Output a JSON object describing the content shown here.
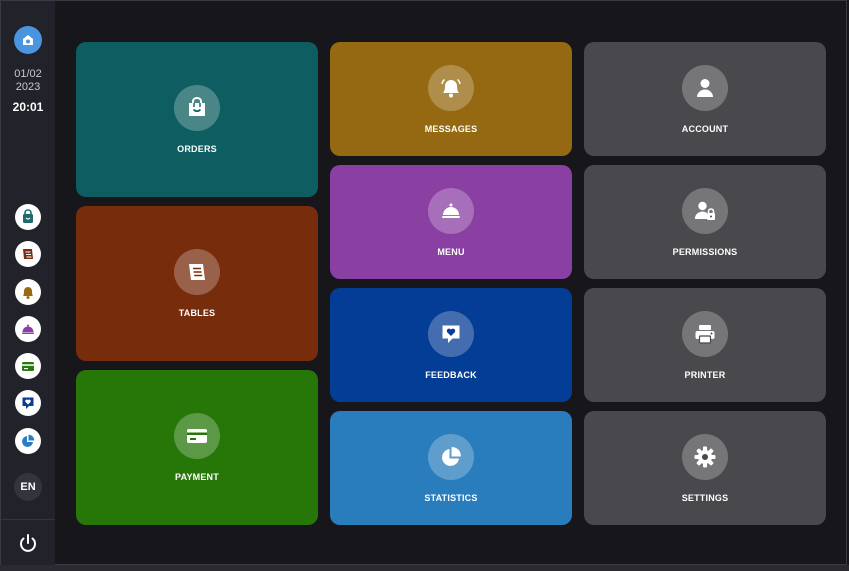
{
  "sidebar": {
    "date_line1": "01/02",
    "date_line2": "2023",
    "time": "20:01",
    "language": "EN",
    "icons": [
      {
        "name": "orders",
        "color": "#1f6b6b"
      },
      {
        "name": "tables",
        "color": "#7a2c10"
      },
      {
        "name": "messages",
        "color": "#9a6a12"
      },
      {
        "name": "menu",
        "color": "#8b3fa6"
      },
      {
        "name": "payment",
        "color": "#277a10"
      },
      {
        "name": "feedback",
        "color": "#0a3d94"
      },
      {
        "name": "statistics",
        "color": "#2a7fc4"
      }
    ]
  },
  "tiles": {
    "orders": {
      "label": "ORDERS",
      "color": "#0e5e61",
      "icon": "shopping-bag-icon"
    },
    "tables": {
      "label": "TABLES",
      "color": "#772c0c",
      "icon": "table-icon"
    },
    "payment": {
      "label": "PAYMENT",
      "color": "#267708",
      "icon": "credit-card-icon"
    },
    "messages": {
      "label": "MESSAGES",
      "color": "#946911",
      "icon": "bell-icon"
    },
    "menu": {
      "label": "MENU",
      "color": "#8a3fa3",
      "icon": "cloche-icon"
    },
    "feedback": {
      "label": "FEEDBACK",
      "color": "#043d95",
      "icon": "heart-message-icon"
    },
    "statistics": {
      "label": "STATISTICS",
      "color": "#2a7dbd",
      "icon": "pie-chart-icon"
    },
    "account": {
      "label": "ACCOUNT",
      "color": "#48484d",
      "icon": "user-icon"
    },
    "permissions": {
      "label": "PERMISSIONS",
      "color": "#48484d",
      "icon": "user-lock-icon"
    },
    "printer": {
      "label": "PRINTER",
      "color": "#48484d",
      "icon": "printer-icon"
    },
    "settings": {
      "label": "SETTINGS",
      "color": "#48484d",
      "icon": "gear-icon"
    }
  }
}
